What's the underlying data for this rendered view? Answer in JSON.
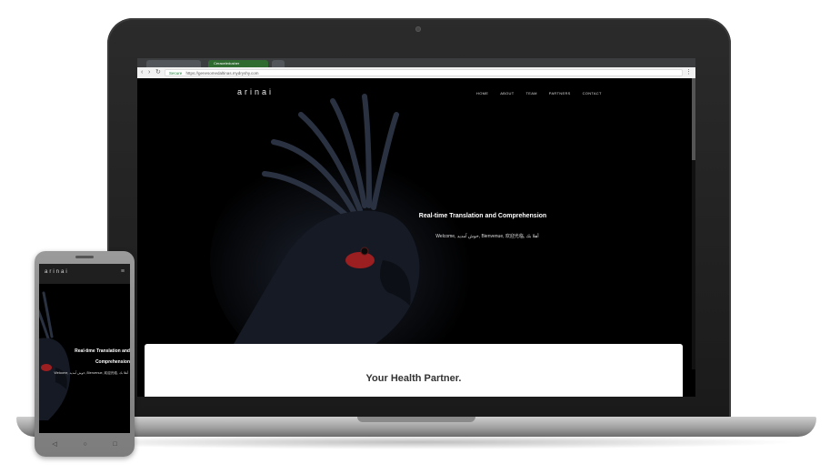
{
  "browser": {
    "tabs": [
      {
        "label": ""
      },
      {
        "label": "Ceraceledusher"
      },
      {
        "label": ""
      }
    ],
    "secure_label": "Secure",
    "url": "https://genesomedaltinas.mydryshy.com"
  },
  "site": {
    "logo": "arinai",
    "nav": [
      "HOME",
      "ABOUT",
      "TEAM",
      "PARTNERS",
      "CONTACT"
    ],
    "hero": {
      "title": "Real-time Translation and Comprehension",
      "subtitle": "Welcome, خوش آمدید, Bienvenue, 欢迎光临, أهلا بك"
    },
    "card": {
      "title": "Your Health Partner."
    }
  },
  "phone": {
    "logo": "arinai",
    "title_line1": "Real-time Translation and",
    "title_line2": "Comprehension",
    "subtitle": "Welcome, خوش آمدید, Bienvenue, 欢迎光临, أهلا بك"
  },
  "colors": {
    "background": "#000000",
    "card": "#ffffff",
    "accent_red": "#b32020"
  }
}
